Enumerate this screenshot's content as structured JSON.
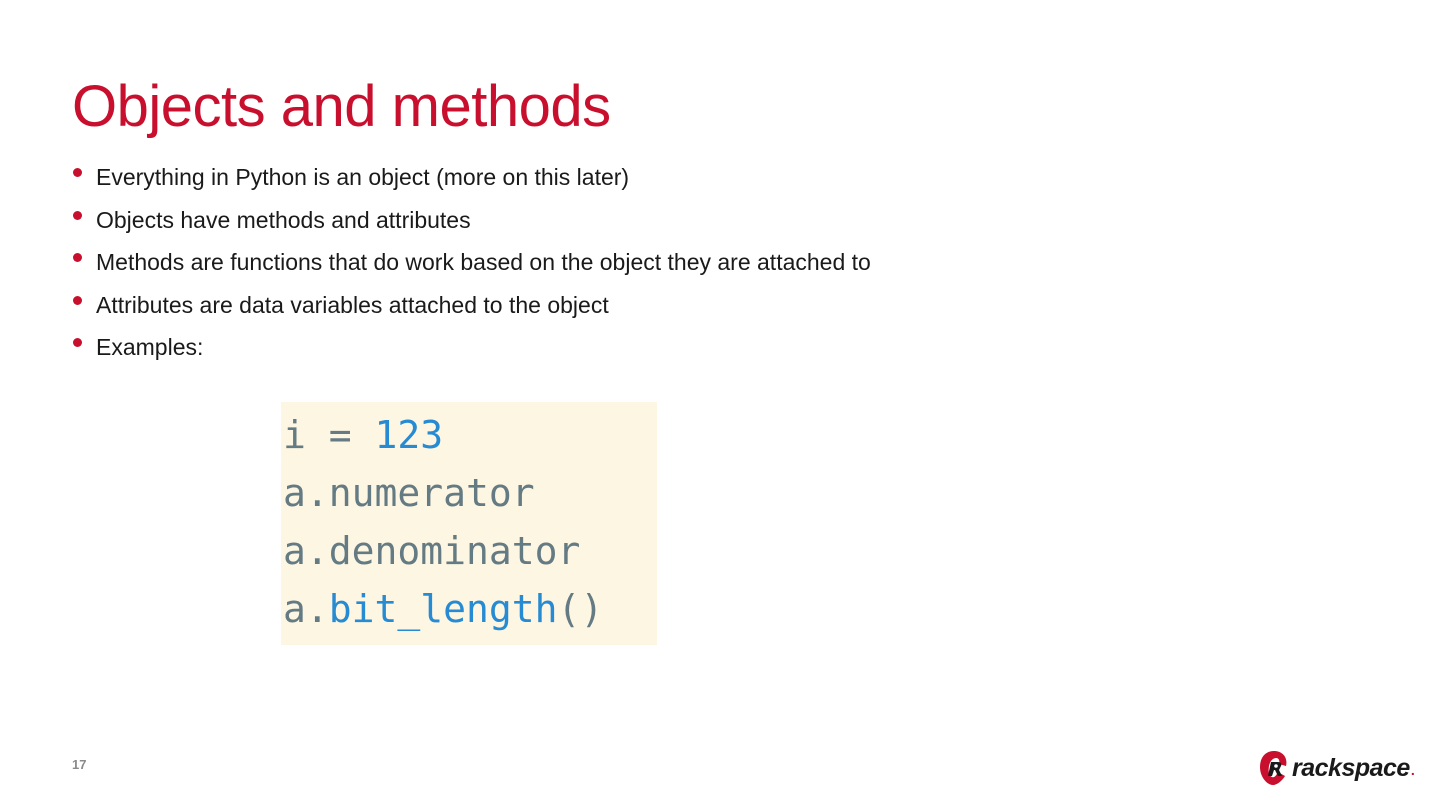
{
  "slide": {
    "title": "Objects and methods",
    "bullets": [
      "Everything in Python is an object (more on this later)",
      "Objects have methods and attributes",
      "Methods are functions that do work based on the object they are attached to",
      "Attributes are data variables attached to the object",
      "Examples:"
    ],
    "code": {
      "line1_var": "i = ",
      "line1_num": "123",
      "line2": "a.numerator",
      "line3": "a.denominator",
      "line4_obj": "a.",
      "line4_fn": "bit_length",
      "line4_paren": "()"
    },
    "page_number": "17"
  },
  "logo": {
    "text": "rackspace",
    "trademark_dot": "."
  },
  "colors": {
    "accent": "#c8102e",
    "code_background": "#fdf6e3",
    "code_text": "#657b83",
    "code_highlight": "#268bd2"
  },
  "icons": {
    "bullet": "red-dot-bullet",
    "logo_mark": "rackspace-logo-icon"
  }
}
